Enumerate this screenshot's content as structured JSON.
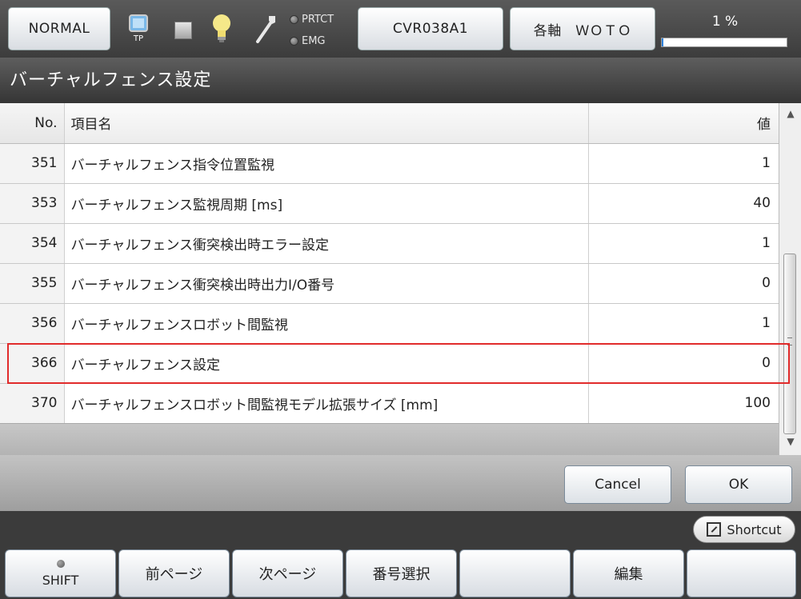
{
  "status_bar": {
    "mode_label": "NORMAL",
    "tp_label": "TP",
    "prtct_label": "PRTCT",
    "emg_label": "EMG",
    "robot_label": "CVR038A1",
    "axis_label": "各軸　ＷＯＴＯ",
    "progress_text": "1 %",
    "progress_percent": 1,
    "accent_color": "#2c7fd8"
  },
  "title": "バーチャルフェンス設定",
  "table": {
    "headers": {
      "no": "No.",
      "name": "項目名",
      "value": "値"
    },
    "rows": [
      {
        "no": "351",
        "name": "バーチャルフェンス指令位置監視",
        "value": "1"
      },
      {
        "no": "353",
        "name": "バーチャルフェンス監視周期 [ms]",
        "value": "40"
      },
      {
        "no": "354",
        "name": "バーチャルフェンス衝突検出時エラー設定",
        "value": "1"
      },
      {
        "no": "355",
        "name": "バーチャルフェンス衝突検出時出力I/O番号",
        "value": "0"
      },
      {
        "no": "356",
        "name": "バーチャルフェンスロボット間監視",
        "value": "1"
      },
      {
        "no": "366",
        "name": "バーチャルフェンス設定",
        "value": "0"
      },
      {
        "no": "370",
        "name": "バーチャルフェンスロボット間監視モデル拡張サイズ [mm]",
        "value": "100"
      }
    ],
    "highlight_color": "#e12b2b"
  },
  "actions": {
    "cancel": "Cancel",
    "ok": "OK"
  },
  "shortcut": {
    "label": "Shortcut"
  },
  "function_keys": [
    {
      "label": "SHIFT"
    },
    {
      "label": "前ページ"
    },
    {
      "label": "次ページ"
    },
    {
      "label": "番号選択"
    },
    {
      "label": ""
    },
    {
      "label": "編集"
    },
    {
      "label": ""
    }
  ]
}
